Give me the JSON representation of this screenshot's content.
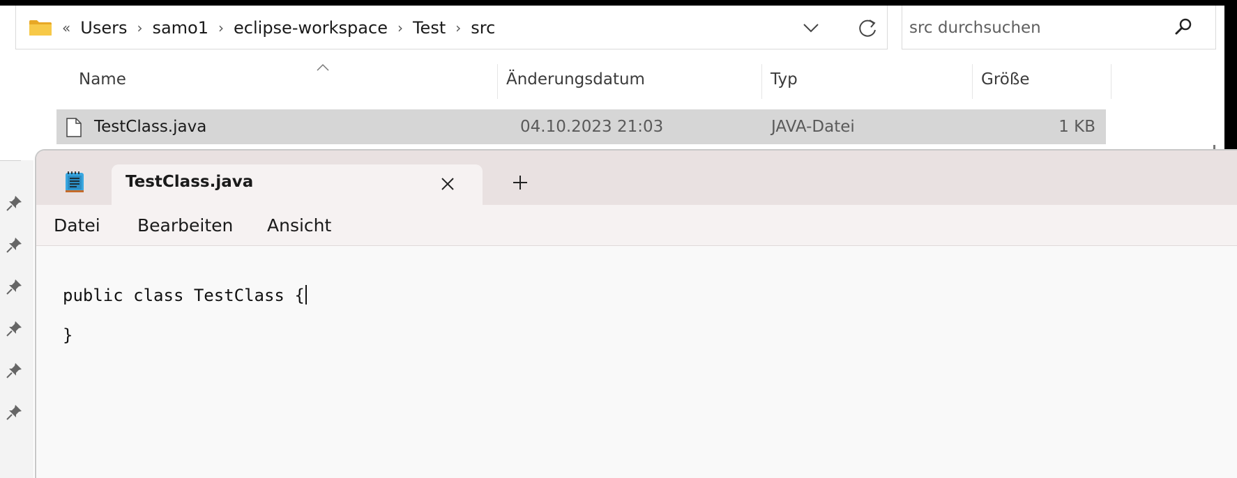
{
  "explorer": {
    "breadcrumb": {
      "overflow": "«",
      "items": [
        "Users",
        "samo1",
        "eclipse-workspace",
        "Test",
        "src"
      ],
      "separator": "›"
    },
    "search": {
      "placeholder": "src durchsuchen"
    },
    "columns": [
      "Name",
      "Änderungsdatum",
      "Typ",
      "Größe"
    ],
    "files": [
      {
        "name": "TestClass.java",
        "modified": "04.10.2023 21:03",
        "type": "JAVA-Datei",
        "size": "1 KB",
        "selected": true
      }
    ]
  },
  "notepad": {
    "tab_title": "TestClass.java",
    "menu": [
      "Datei",
      "Bearbeiten",
      "Ansicht"
    ],
    "content": [
      "public class TestClass {",
      "}"
    ]
  },
  "colors": {
    "selection": "#d6d6d6",
    "titlebar": "#e9e1e1",
    "folder": "#f4c542"
  }
}
